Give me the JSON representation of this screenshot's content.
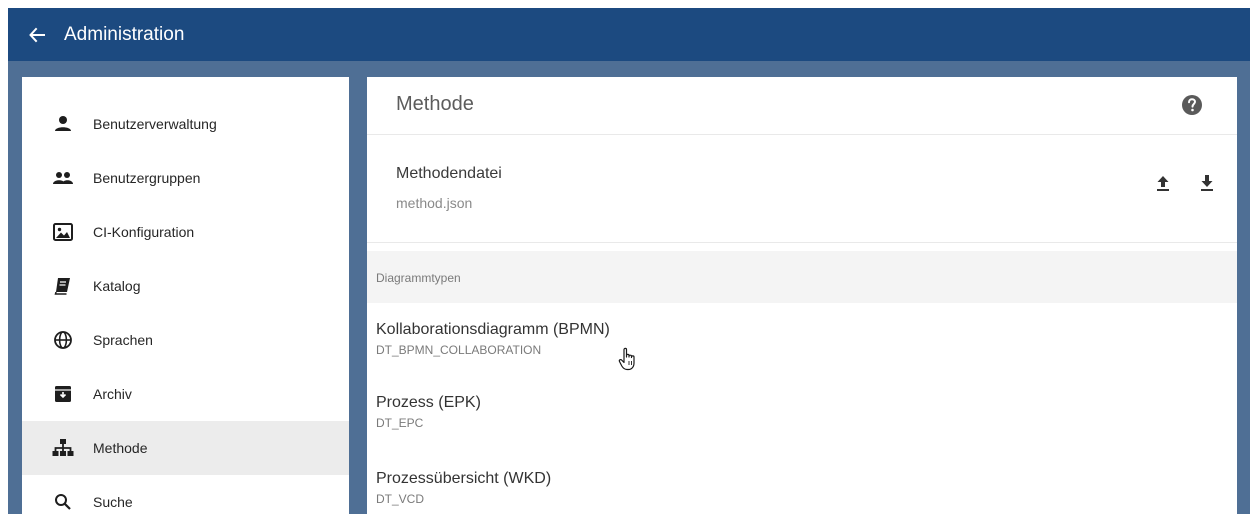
{
  "header": {
    "title": "Administration",
    "back_icon": "arrow-left-icon"
  },
  "sidebar": {
    "items": [
      {
        "label": "Benutzerverwaltung",
        "icon": "person-icon",
        "active": false
      },
      {
        "label": "Benutzergruppen",
        "icon": "people-icon",
        "active": false
      },
      {
        "label": "CI-Konfiguration",
        "icon": "image-icon",
        "active": false
      },
      {
        "label": "Katalog",
        "icon": "book-icon",
        "active": false
      },
      {
        "label": "Sprachen",
        "icon": "globe-icon",
        "active": false
      },
      {
        "label": "Archiv",
        "icon": "archive-icon",
        "active": false
      },
      {
        "label": "Methode",
        "icon": "sitemap-icon",
        "active": true
      },
      {
        "label": "Suche",
        "icon": "search-icon",
        "active": false
      }
    ]
  },
  "panel": {
    "title": "Methode",
    "help_icon": "help-icon",
    "file": {
      "label": "Methodendatei",
      "name": "method.json",
      "upload_icon": "upload-icon",
      "download_icon": "download-icon"
    },
    "section_title": "Diagrammtypen",
    "diagram_types": [
      {
        "name": "Kollaborationsdiagramm (BPMN)",
        "code": "DT_BPMN_COLLABORATION"
      },
      {
        "name": "Prozess (EPK)",
        "code": "DT_EPC"
      },
      {
        "name": "Prozessübersicht (WKD)",
        "code": "DT_VCD"
      }
    ]
  },
  "colors": {
    "header_bg": "#1c4a80",
    "backdrop": "#4f6f95",
    "active_item_bg": "#ececec"
  }
}
